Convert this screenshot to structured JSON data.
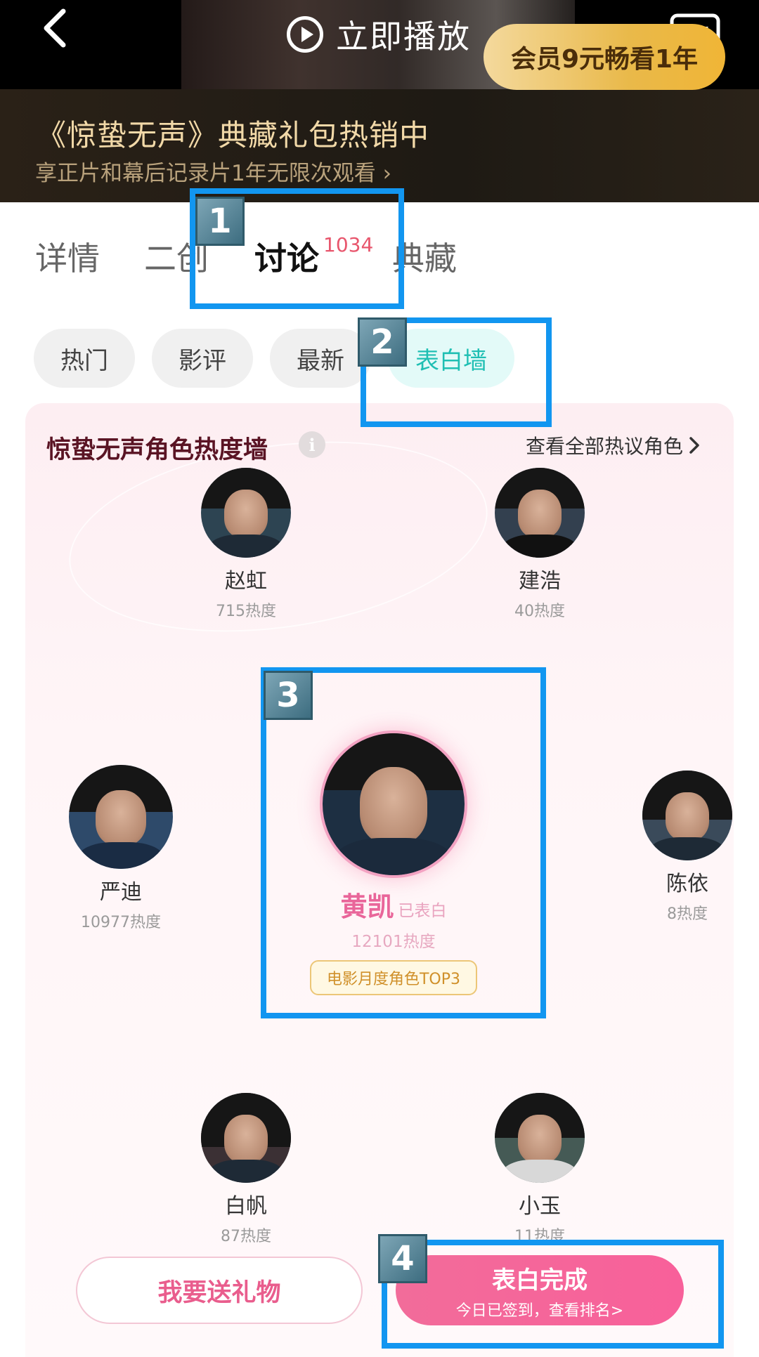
{
  "topbar": {
    "play_label": "立即播放"
  },
  "promo": {
    "title": "《惊蛰无声》典藏礼包热销中",
    "subtitle": "享正片和幕后记录片1年无限次观看 ›",
    "button_label": "会员9元畅看1年"
  },
  "tabs": [
    {
      "label": "详情"
    },
    {
      "label": "二创"
    },
    {
      "label": "讨论",
      "badge": "1034"
    },
    {
      "label": "典藏"
    }
  ],
  "filters": [
    {
      "label": "热门"
    },
    {
      "label": "影评"
    },
    {
      "label": "最新"
    },
    {
      "label": "表白墙"
    }
  ],
  "wall": {
    "title": "惊蛰无声角色热度墙",
    "info_glyph": "i",
    "see_all_label": "查看全部热议角色"
  },
  "characters": [
    {
      "name": "赵虹",
      "heat": "715热度"
    },
    {
      "name": "建浩",
      "heat": "40热度"
    },
    {
      "name": "严迪",
      "heat": "10977热度"
    },
    {
      "name": "陈依",
      "heat": "8热度"
    },
    {
      "name": "白帆",
      "heat": "87热度"
    },
    {
      "name": "小玉",
      "heat": "11热度"
    }
  ],
  "hero": {
    "name": "黄凯",
    "tag": "已表白",
    "heat": "12101热度",
    "badge": "电影月度角色TOP3"
  },
  "buttons": {
    "gift_label": "我要送礼物",
    "confess_main": "表白完成",
    "confess_sub": "今日已签到，查看排名>"
  },
  "annotations": [
    "1",
    "2",
    "3",
    "4"
  ],
  "colors": {
    "accent_teal": "#1fbfb3",
    "accent_pink": "#f26c9a",
    "annotation_blue": "#1296f0",
    "promo_gold": "#e9b94a"
  }
}
